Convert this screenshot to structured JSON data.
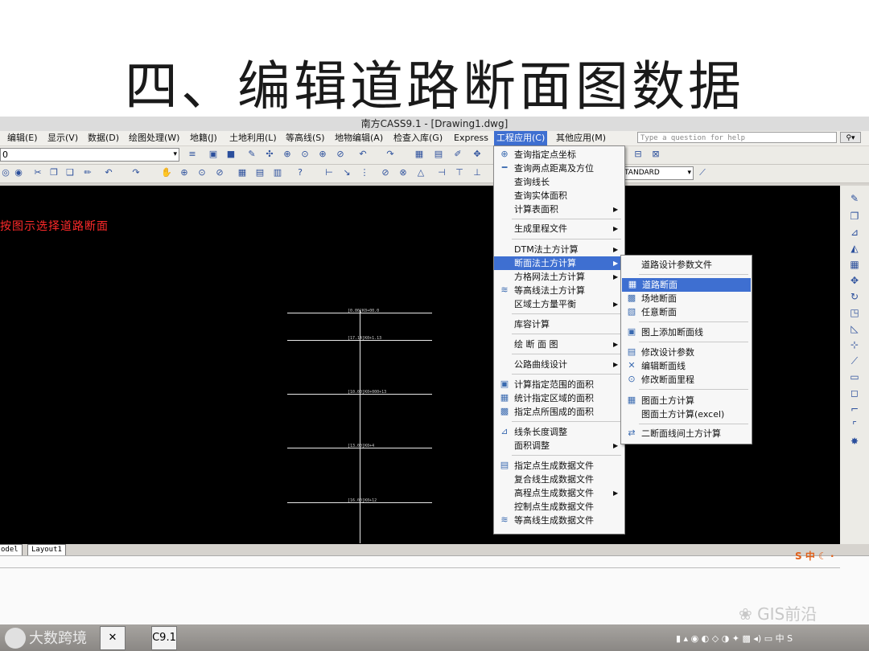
{
  "slide": {
    "title": "四、编辑道路断面图数据"
  },
  "window": {
    "title": "南方CASS9.1 - [Drawing1.dwg]"
  },
  "menubar": {
    "items": [
      {
        "label": "编辑(E)"
      },
      {
        "label": "显示(V)"
      },
      {
        "label": "数据(D)"
      },
      {
        "label": "绘图处理(W)"
      },
      {
        "label": "地籍(J)"
      },
      {
        "label": "土地利用(L)"
      },
      {
        "label": "等高线(S)"
      },
      {
        "label": "地物编辑(A)"
      },
      {
        "label": "检查入库(G)"
      },
      {
        "label": "Express"
      },
      {
        "label": "工程应用(C)"
      },
      {
        "label": "其他应用(M)"
      }
    ],
    "active": "工程应用(C)",
    "help_placeholder": "Type a question for help"
  },
  "toolbar": {
    "layer_value": "0",
    "style_value": "TANDARD"
  },
  "canvas": {
    "prompt": "按图示选择道路断面",
    "station_labels": [
      "[0.00]K0+00.0",
      "[17.14]K0+1.13",
      "[10.00]K0+000+13",
      "[13.00]K0+4",
      "[16.00]K0+12"
    ]
  },
  "engineering_menu": {
    "items": [
      {
        "label": "查询指定点坐标",
        "icon": "coordinate-icon"
      },
      {
        "label": "查询两点距离及方位",
        "icon": "distance-icon"
      },
      {
        "label": "查询线长"
      },
      {
        "label": "查询实体面积"
      },
      {
        "label": "计算表面积",
        "submenu": true
      },
      {
        "label": "生成里程文件",
        "submenu": true
      },
      {
        "label": "DTM法土方计算",
        "submenu": true
      },
      {
        "label": "断面法土方计算",
        "submenu": true,
        "highlighted": true
      },
      {
        "label": "方格网法土方计算",
        "submenu": true
      },
      {
        "label": "等高线法土方计算",
        "icon": "contour-calc-icon"
      },
      {
        "label": "区域土方量平衡",
        "submenu": true
      },
      {
        "label": "库容计算"
      },
      {
        "label": "绘 断 面 图",
        "submenu": true
      },
      {
        "label": "公路曲线设计",
        "submenu": true
      },
      {
        "label": "计算指定范围的面积",
        "icon": "area-range-icon"
      },
      {
        "label": "统计指定区域的面积",
        "icon": "area-stat-icon"
      },
      {
        "label": "指定点所围成的面积",
        "icon": "area-points-icon"
      },
      {
        "label": "线条长度调整",
        "icon": "line-length-icon"
      },
      {
        "label": "面积调整",
        "submenu": true
      },
      {
        "label": "指定点生成数据文件",
        "icon": "data-file-icon"
      },
      {
        "label": "复合线生成数据文件"
      },
      {
        "label": "高程点生成数据文件",
        "submenu": true
      },
      {
        "label": "控制点生成数据文件"
      },
      {
        "label": "等高线生成数据文件",
        "icon": "contour-file-icon"
      }
    ]
  },
  "section_submenu": {
    "items": [
      {
        "label": "道路设计参数文件"
      },
      {
        "label": "道路断面",
        "icon": "road-section-icon",
        "highlighted": true
      },
      {
        "label": "场地断面",
        "icon": "site-section-icon"
      },
      {
        "label": "任意断面",
        "icon": "arbitrary-section-icon"
      },
      {
        "label": "图上添加断面线",
        "icon": "add-section-line-icon"
      },
      {
        "label": "修改设计参数",
        "icon": "modify-param-icon"
      },
      {
        "label": "编辑断面线",
        "icon": "edit-section-line-icon"
      },
      {
        "label": "修改断面里程",
        "icon": "modify-mileage-icon"
      },
      {
        "label": "图面土方计算",
        "icon": "earthwork-icon"
      },
      {
        "label": "图面土方计算(excel)"
      },
      {
        "label": "二断面线间土方计算",
        "icon": "two-section-icon"
      }
    ]
  },
  "tabs": {
    "model": "odel",
    "layout": "Layout1"
  },
  "ime": {
    "label": "中"
  },
  "taskbar": {
    "left_text": "大数跨境",
    "app_label": "C9.1",
    "tray_lang": "中"
  },
  "watermark": "GIS前沿"
}
